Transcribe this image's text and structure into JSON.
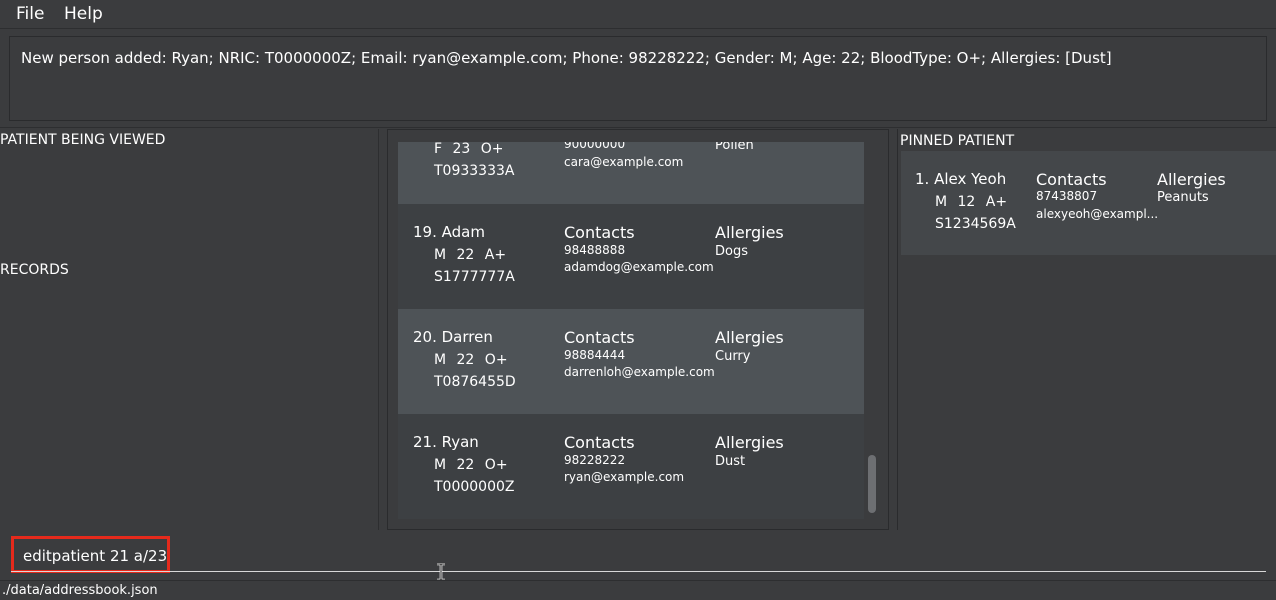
{
  "menu": {
    "file": "File",
    "help": "Help"
  },
  "result": {
    "text": "New person added: Ryan; NRIC: T0000000Z; Email: ryan@example.com; Phone: 98228222; Gender: M; Age: 22; BloodType: O+; Allergies: [Dust]"
  },
  "sections": {
    "viewed": "PATIENT BEING VIEWED",
    "records": "RECORDS",
    "pinned": "PINNED PATIENT"
  },
  "patients": [
    {
      "name": "",
      "meta": "F 23 O+",
      "nric": "T0933333A",
      "contacts_header": "",
      "phone": "90000000",
      "email": "cara@example.com",
      "allergies_header": "",
      "allergies": "Pollen"
    },
    {
      "name": "19. Adam",
      "meta": "M 22 A+",
      "nric": "S1777777A",
      "contacts_header": "Contacts",
      "phone": "98488888",
      "email": "adamdog@example.com",
      "allergies_header": "Allergies",
      "allergies": "Dogs"
    },
    {
      "name": "20. Darren",
      "meta": "M 22 O+",
      "nric": "T0876455D",
      "contacts_header": "Contacts",
      "phone": "98884444",
      "email": "darrenloh@example.com",
      "allergies_header": "Allergies",
      "allergies": "Curry"
    },
    {
      "name": "21. Ryan",
      "meta": "M 22 O+",
      "nric": "T0000000Z",
      "contacts_header": "Contacts",
      "phone": "98228222",
      "email": "ryan@example.com",
      "allergies_header": "Allergies",
      "allergies": "Dust"
    }
  ],
  "pinned": {
    "name": "1. Alex Yeoh",
    "meta": "M 12 A+",
    "nric": "S1234569A",
    "contacts_header": "Contacts",
    "phone": "87438807",
    "email": "alexyeoh@exampl...",
    "allergies_header": "Allergies",
    "allergies": "Peanuts"
  },
  "command": {
    "value": "editpatient 21 a/23"
  },
  "status": {
    "path": "./data/addressbook.json"
  },
  "colors": {
    "card_light": "#4e5357",
    "card_dark": "#3d4043",
    "command_border": "#e52a1c"
  }
}
